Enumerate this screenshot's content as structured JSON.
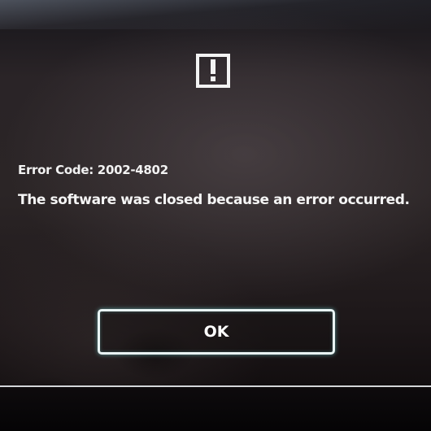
{
  "dialog": {
    "icon": "exclamation-icon",
    "error_code": "Error Code: 2002-4802",
    "message": "The software was closed because an error occurred.",
    "ok_label": "OK"
  },
  "colors": {
    "background": "#2b2526",
    "text": "#f5f5f5",
    "button_border": "#e9f4f4",
    "focus_glow": "#78dcdc"
  }
}
